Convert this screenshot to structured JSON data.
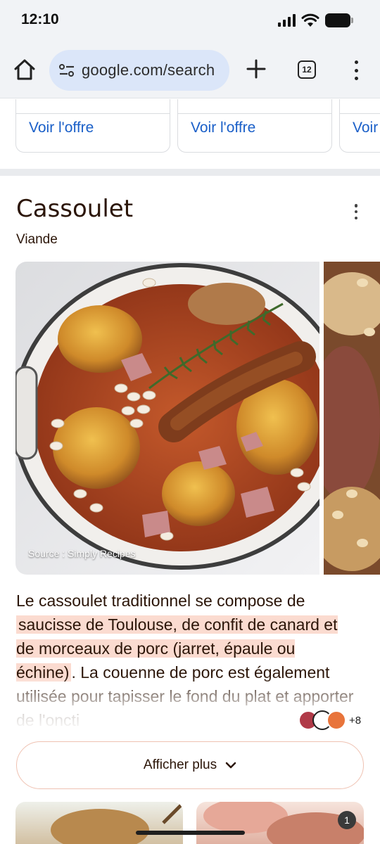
{
  "status_bar": {
    "time": "12:10"
  },
  "browser": {
    "url": "google.com/search",
    "tab_count": "12"
  },
  "offers": [
    {
      "link": "Voir l'offre"
    },
    {
      "link": "Voir l'offre"
    },
    {
      "link": "Voir"
    }
  ],
  "panel": {
    "title": "Cassoulet",
    "subtitle": "Viande",
    "image_source": "Source : Simply Recipes",
    "description": {
      "text_before": "Le cassoulet traditionnel se compose de ",
      "highlight": "saucisse de Toulouse, de confit de canard et de morceaux de porc (jarret, épaule ou échine)",
      "text_after": ". La couenne de porc est également utilisée pour tapisser le fond du plat et apporter de l'oncti"
    },
    "sources_more": "+8",
    "show_more_label": "Afficher plus"
  },
  "bottom_badge": "1",
  "colors": {
    "accent_link": "#1a5fc8",
    "highlight": "#fbdbd0",
    "title_text": "#2b1508",
    "url_pill": "#dbe6f9"
  }
}
